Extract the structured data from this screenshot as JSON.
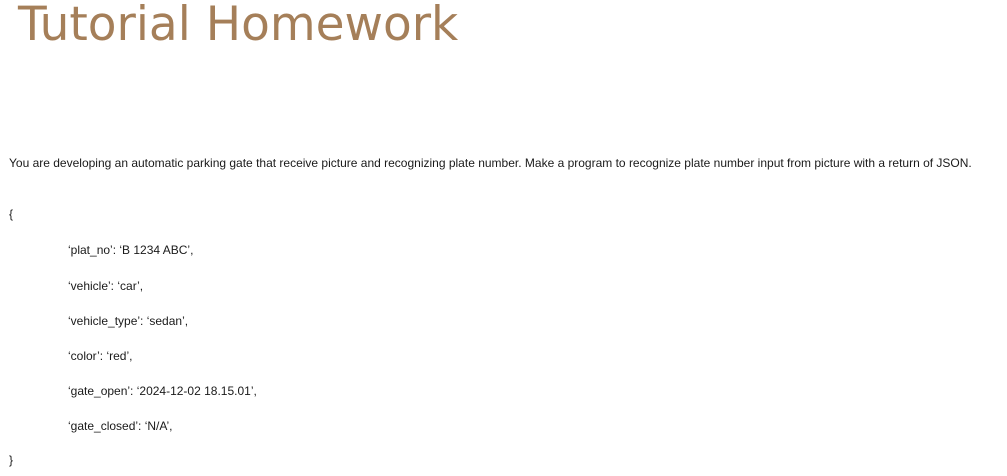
{
  "doc": {
    "title": "Tutorial Homework",
    "paragraph": "You are developing an automatic parking gate that receive picture and recognizing plate number. Make a program to recognize plate number input from picture with a return of JSON.",
    "brace_open": "{",
    "brace_close": "}",
    "fields": [
      "‘plat_no’: ‘B 1234 ABC’,",
      "‘vehicle’: ‘car’,",
      "‘vehicle_type’: ‘sedan’,",
      "‘color’: ‘red’,",
      "‘gate_open’: ‘2024-12-02 18.15.01’,",
      "‘gate_closed’: ‘N/A’,"
    ]
  }
}
